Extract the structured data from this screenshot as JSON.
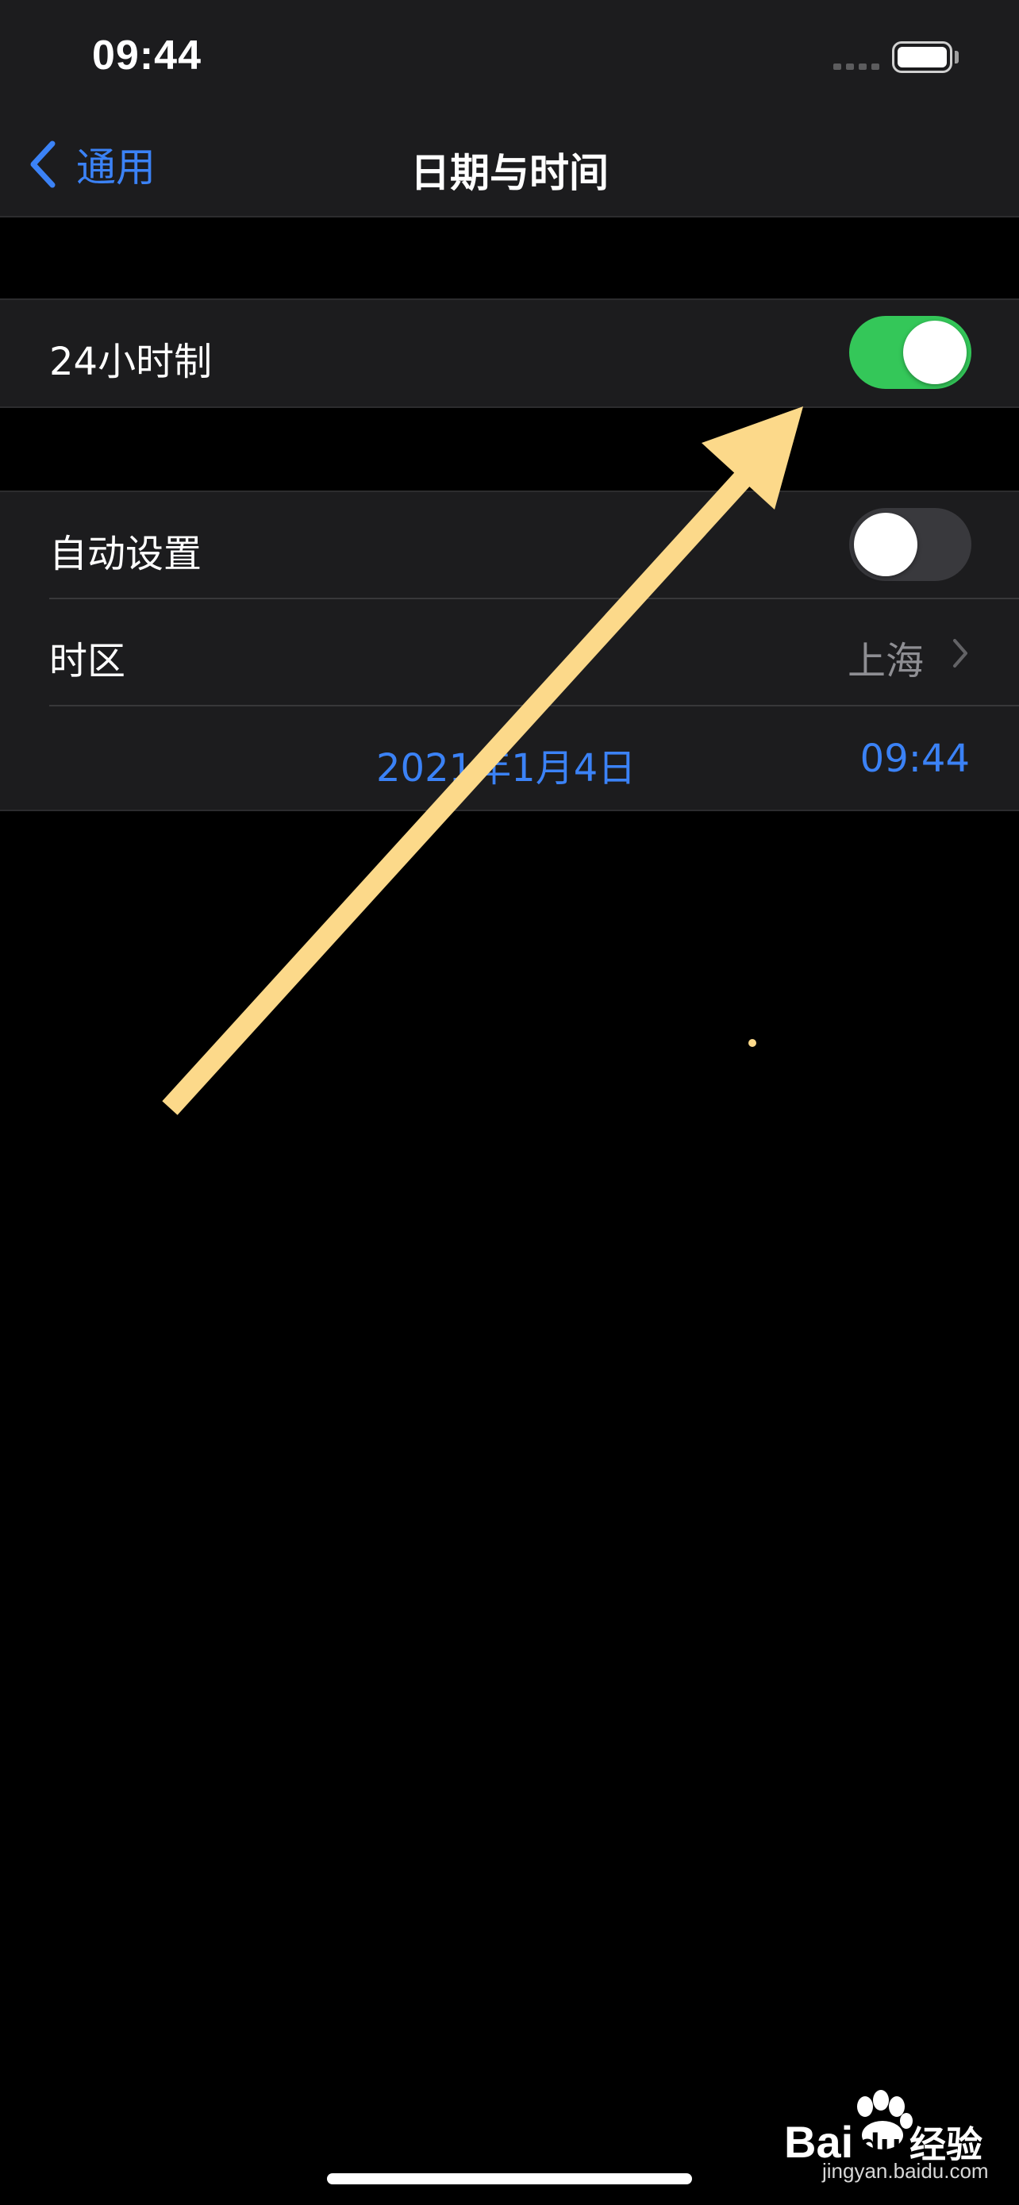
{
  "status_bar": {
    "time": "09:44"
  },
  "nav": {
    "back_label": "通用",
    "title": "日期与时间"
  },
  "settings": {
    "hour24": {
      "label": "24小时制",
      "enabled": true
    },
    "auto_set": {
      "label": "自动设置",
      "enabled": false
    },
    "timezone": {
      "label": "时区",
      "value": "上海"
    },
    "datetime": {
      "date": "2021年1月4日",
      "time": "09:44"
    }
  },
  "watermark": {
    "brand": "Baidu经验",
    "url": "jingyan.baidu.com"
  },
  "icons": {
    "back": "chevron-left-icon",
    "disclosure": "chevron-right-icon",
    "annotation": "arrow-icon"
  },
  "colors": {
    "accent": "#3b82f6",
    "toggle_on": "#34c759",
    "annotation_arrow": "#fcd98a"
  }
}
